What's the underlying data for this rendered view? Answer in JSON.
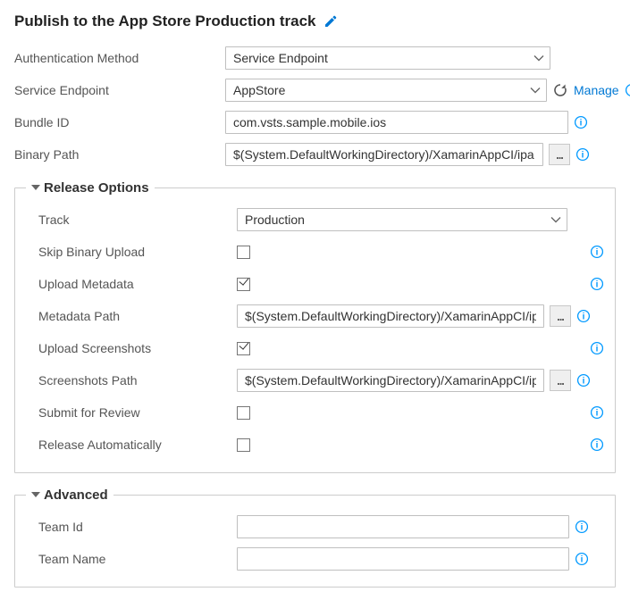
{
  "title": "Publish to the App Store Production track",
  "fields": {
    "auth_method": {
      "label": "Authentication Method",
      "value": "Service Endpoint"
    },
    "service_endpoint": {
      "label": "Service Endpoint",
      "value": "AppStore",
      "manage": "Manage"
    },
    "bundle_id": {
      "label": "Bundle ID",
      "value": "com.vsts.sample.mobile.ios"
    },
    "binary_path": {
      "label": "Binary Path",
      "value": "$(System.DefaultWorkingDirectory)/XamarinAppCI/ipa"
    }
  },
  "release": {
    "legend": "Release Options",
    "track": {
      "label": "Track",
      "value": "Production"
    },
    "skip_binary": {
      "label": "Skip Binary Upload",
      "checked": false
    },
    "upload_metadata": {
      "label": "Upload Metadata",
      "checked": true
    },
    "metadata_path": {
      "label": "Metadata Path",
      "value": "$(System.DefaultWorkingDirectory)/XamarinAppCI/ipa"
    },
    "upload_screenshots": {
      "label": "Upload Screenshots",
      "checked": true
    },
    "screenshots_path": {
      "label": "Screenshots Path",
      "value": "$(System.DefaultWorkingDirectory)/XamarinAppCI/ipa"
    },
    "submit_review": {
      "label": "Submit for Review",
      "checked": false
    },
    "release_auto": {
      "label": "Release Automatically",
      "checked": false
    }
  },
  "advanced": {
    "legend": "Advanced",
    "team_id": {
      "label": "Team Id",
      "value": ""
    },
    "team_name": {
      "label": "Team Name",
      "value": ""
    }
  }
}
